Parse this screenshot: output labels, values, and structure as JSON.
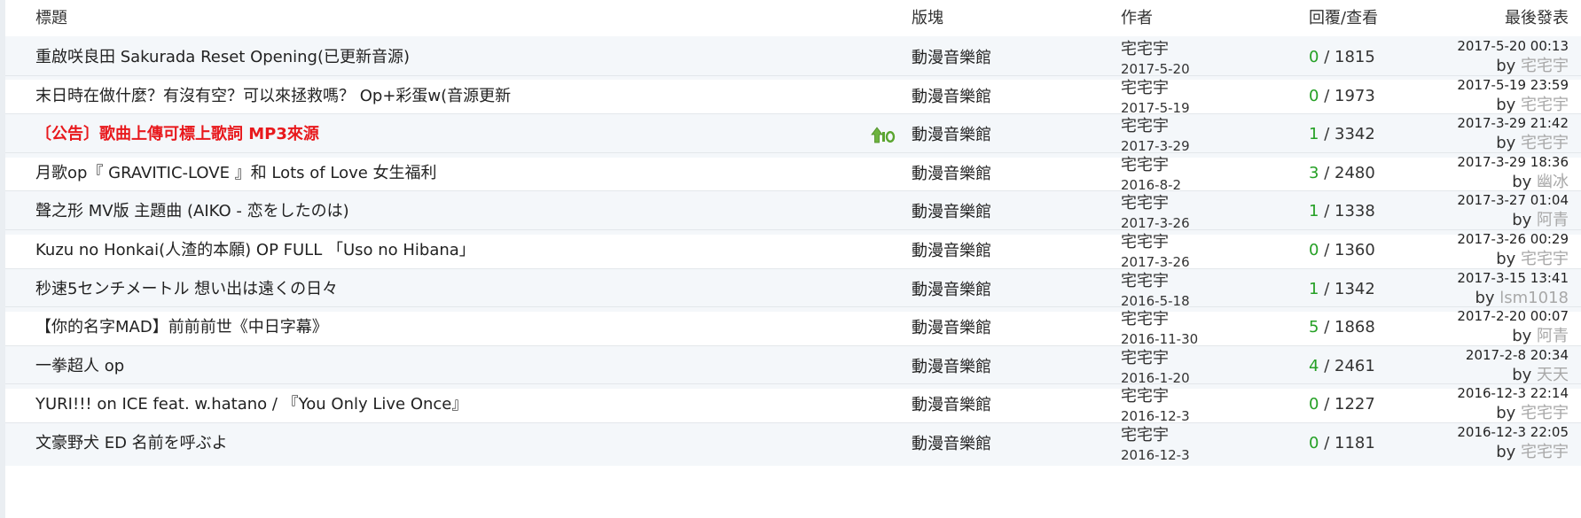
{
  "header": {
    "title": "標題",
    "forum": "版塊",
    "author": "作者",
    "stats": "回覆/查看",
    "last": "最後發表"
  },
  "stats_separator": "/",
  "by_label": "by",
  "colors": {
    "notice": "#e8191d",
    "replies": "#25a025",
    "last_poster": "#a8a8a8",
    "alt_row": "#f4f7fa"
  },
  "top_badge_icon": "top-10-badge-icon",
  "threads": [
    {
      "title": "重啟咲良田 Sakurada Reset Opening(已更新音源)",
      "forum": "動漫音樂館",
      "author": "宅宅宇",
      "date": "2017-5-20",
      "replies": "0",
      "views": "1815",
      "last_time": "2017-5-20 00:13",
      "last_user": "宅宅宇"
    },
    {
      "title": "末日時在做什麼？有沒有空？可以來拯救嗎？ Op+彩蛋w(音源更新",
      "forum": "動漫音樂館",
      "author": "宅宅宇",
      "date": "2017-5-19",
      "replies": "0",
      "views": "1973",
      "last_time": "2017-5-19 23:59",
      "last_user": "宅宅宇"
    },
    {
      "title": "〔公告〕歌曲上傳可標上歌詞 MP3來源",
      "forum": "動漫音樂館",
      "author": "宅宅宇",
      "date": "2017-3-29",
      "replies": "1",
      "views": "3342",
      "last_time": "2017-3-29 21:42",
      "last_user": "宅宅宇",
      "notice": true,
      "top": true
    },
    {
      "title": "月歌op『 GRAVITIC-LOVE 』和 Lots of Love 女生福利",
      "forum": "動漫音樂館",
      "author": "宅宅宇",
      "date": "2016-8-2",
      "replies": "3",
      "views": "2480",
      "last_time": "2017-3-29 18:36",
      "last_user": "幽冰"
    },
    {
      "title": "聲之形 MV版 主題曲 (AIKO - 恋をしたのは)",
      "forum": "動漫音樂館",
      "author": "宅宅宇",
      "date": "2017-3-26",
      "replies": "1",
      "views": "1338",
      "last_time": "2017-3-27 01:04",
      "last_user": "阿青"
    },
    {
      "title": "Kuzu no Honkai(人渣的本願) OP FULL 「Uso no Hibana」",
      "forum": "動漫音樂館",
      "author": "宅宅宇",
      "date": "2017-3-26",
      "replies": "0",
      "views": "1360",
      "last_time": "2017-3-26 00:29",
      "last_user": "宅宅宇"
    },
    {
      "title": "秒速5センチメートル 想い出は遠くの日々",
      "forum": "動漫音樂館",
      "author": "宅宅宇",
      "date": "2016-5-18",
      "replies": "1",
      "views": "1342",
      "last_time": "2017-3-15 13:41",
      "last_user": "lsm1018"
    },
    {
      "title": "【你的名字MAD】前前前世《中日字幕》",
      "forum": "動漫音樂館",
      "author": "宅宅宇",
      "date": "2016-11-30",
      "replies": "5",
      "views": "1868",
      "last_time": "2017-2-20 00:07",
      "last_user": "阿青"
    },
    {
      "title": "一拳超人 op",
      "forum": "動漫音樂館",
      "author": "宅宅宇",
      "date": "2016-1-20",
      "replies": "4",
      "views": "2461",
      "last_time": "2017-2-8 20:34",
      "last_user": "天天"
    },
    {
      "title": "YURI!!! on ICE feat. w.hatano / 『You Only Live Once』",
      "forum": "動漫音樂館",
      "author": "宅宅宇",
      "date": "2016-12-3",
      "replies": "0",
      "views": "1227",
      "last_time": "2016-12-3 22:14",
      "last_user": "宅宅宇"
    },
    {
      "title": "文豪野犬 ED 名前を呼ぶよ",
      "forum": "動漫音樂館",
      "author": "宅宅宇",
      "date": "2016-12-3",
      "replies": "0",
      "views": "1181",
      "last_time": "2016-12-3 22:05",
      "last_user": "宅宅宇"
    }
  ]
}
